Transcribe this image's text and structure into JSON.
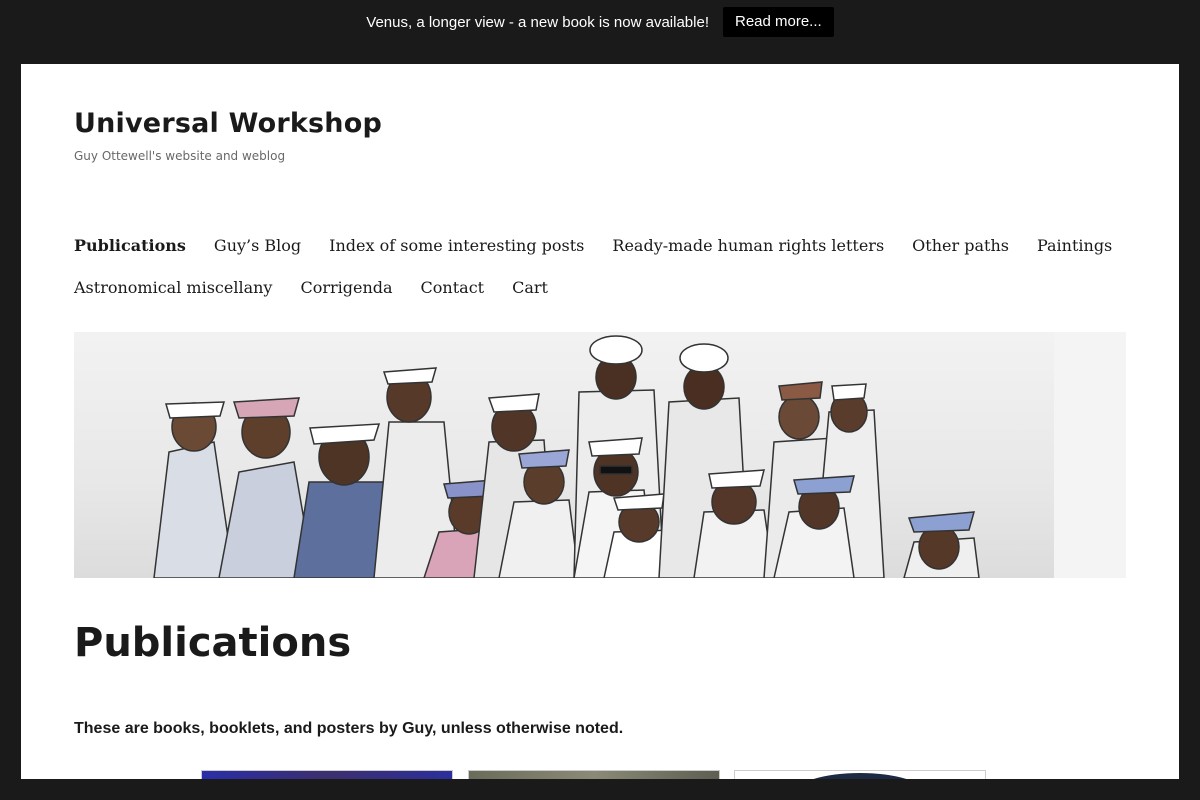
{
  "banner": {
    "text": "Venus, a longer view - a new book is now available!",
    "button_label": "Read more..."
  },
  "site": {
    "title": "Universal Workshop",
    "description": "Guy Ottewell's website and weblog"
  },
  "nav": {
    "row1": [
      {
        "label": "Publications",
        "active": true
      },
      {
        "label": "Guy’s Blog"
      },
      {
        "label": "Index of some interesting posts"
      },
      {
        "label": "Ready-made human rights letters"
      },
      {
        "label": "Other paths"
      },
      {
        "label": "Paintings"
      }
    ],
    "row2": [
      {
        "label": "Astronomical miscellany"
      },
      {
        "label": "Corrigenda"
      },
      {
        "label": "Contact"
      },
      {
        "label": "Cart"
      }
    ]
  },
  "main": {
    "title": "Publications",
    "intro": "These are books, booklets, and posters by Guy, unless otherwise noted."
  },
  "colors": {
    "background": "#1a1a1a",
    "page": "#ffffff",
    "text": "#1a1a1a",
    "muted": "#686868"
  }
}
